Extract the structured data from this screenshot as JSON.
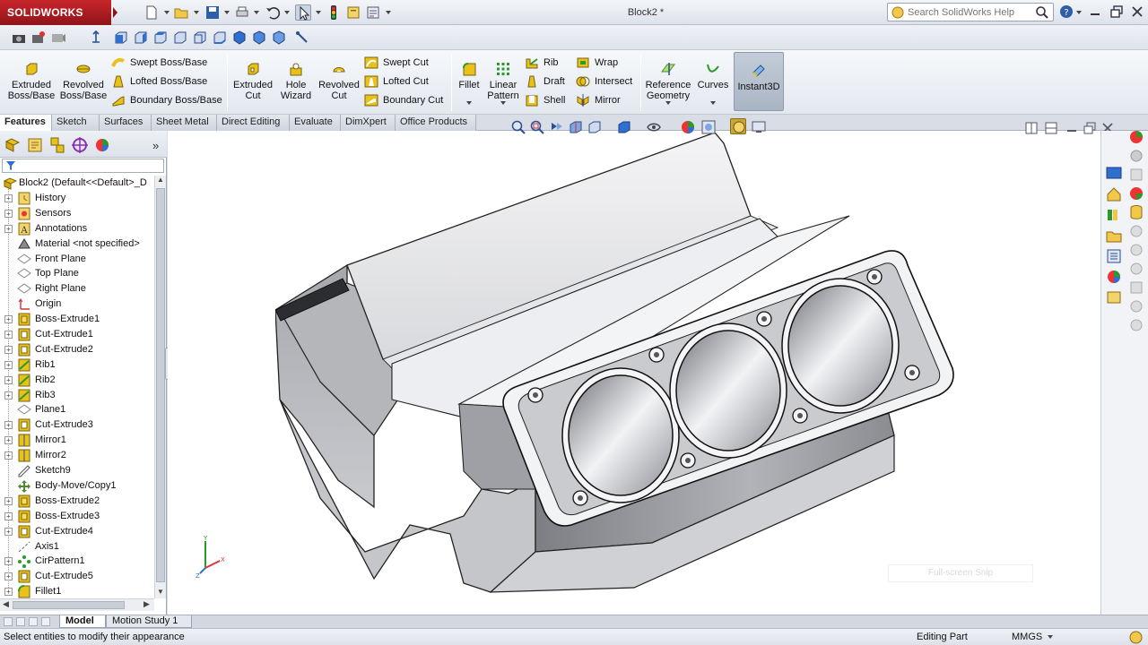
{
  "app": {
    "logo_text": "SOLIDWORKS",
    "document_title": "Block2 *"
  },
  "search": {
    "placeholder": "Search SolidWorks Help"
  },
  "command_manager": {
    "extrude_group": [
      {
        "label": "Extruded\nBoss/Base"
      },
      {
        "label": "Revolved\nBoss/Base"
      }
    ],
    "boss_small": [
      {
        "label": "Swept Boss/Base"
      },
      {
        "label": "Lofted Boss/Base"
      },
      {
        "label": "Boundary Boss/Base"
      }
    ],
    "cut_group": [
      {
        "label": "Extruded\nCut"
      },
      {
        "label": "Hole\nWizard"
      },
      {
        "label": "Revolved\nCut"
      }
    ],
    "cut_small": [
      {
        "label": "Swept Cut"
      },
      {
        "label": "Lofted Cut"
      },
      {
        "label": "Boundary Cut"
      }
    ],
    "fillet": {
      "label": "Fillet"
    },
    "linear_pattern": {
      "label": "Linear\nPattern"
    },
    "feature_small_a": [
      {
        "label": "Rib"
      },
      {
        "label": "Draft"
      },
      {
        "label": "Shell"
      }
    ],
    "feature_small_b": [
      {
        "label": "Wrap"
      },
      {
        "label": "Intersect"
      },
      {
        "label": "Mirror"
      }
    ],
    "reference_geometry": {
      "label": "Reference\nGeometry"
    },
    "curves": {
      "label": "Curves"
    },
    "instant3d": {
      "label": "Instant3D"
    }
  },
  "tabs": [
    {
      "label": "Features"
    },
    {
      "label": "Sketch"
    },
    {
      "label": "Surfaces"
    },
    {
      "label": "Sheet Metal"
    },
    {
      "label": "Direct Editing"
    },
    {
      "label": "Evaluate"
    },
    {
      "label": "DimXpert"
    },
    {
      "label": "Office Products"
    }
  ],
  "feature_tree": {
    "root": "Block2  (Default<<Default>_D",
    "items": [
      {
        "label": "History",
        "icon": "history-icon"
      },
      {
        "label": "Sensors",
        "icon": "sensor-icon"
      },
      {
        "label": "Annotations",
        "icon": "annotation-icon"
      },
      {
        "label": "Material <not specified>",
        "icon": "material-icon"
      },
      {
        "label": "Front Plane",
        "icon": "plane-icon"
      },
      {
        "label": "Top Plane",
        "icon": "plane-icon"
      },
      {
        "label": "Right Plane",
        "icon": "plane-icon"
      },
      {
        "label": "Origin",
        "icon": "origin-icon"
      },
      {
        "label": "Boss-Extrude1",
        "icon": "extrude-icon"
      },
      {
        "label": "Cut-Extrude1",
        "icon": "cut-icon"
      },
      {
        "label": "Cut-Extrude2",
        "icon": "cut-icon"
      },
      {
        "label": "Rib1",
        "icon": "rib-icon"
      },
      {
        "label": "Rib2",
        "icon": "rib-icon"
      },
      {
        "label": "Rib3",
        "icon": "rib-icon"
      },
      {
        "label": "Plane1",
        "icon": "plane-icon"
      },
      {
        "label": "Cut-Extrude3",
        "icon": "cut-icon"
      },
      {
        "label": "Mirror1",
        "icon": "mirror-icon"
      },
      {
        "label": "Mirror2",
        "icon": "mirror-icon"
      },
      {
        "label": "Sketch9",
        "icon": "sketch-icon"
      },
      {
        "label": "Body-Move/Copy1",
        "icon": "move-icon"
      },
      {
        "label": "Boss-Extrude2",
        "icon": "extrude-icon"
      },
      {
        "label": "Boss-Extrude3",
        "icon": "extrude-icon"
      },
      {
        "label": "Cut-Extrude4",
        "icon": "cut-icon"
      },
      {
        "label": "Axis1",
        "icon": "axis-icon"
      },
      {
        "label": "CirPattern1",
        "icon": "pattern-icon"
      },
      {
        "label": "Cut-Extrude5",
        "icon": "cut-icon"
      },
      {
        "label": "Fillet1",
        "icon": "fillet-icon"
      }
    ]
  },
  "viewport": {
    "snip_hint": "Full-screen Snip"
  },
  "bottom_tabs": [
    {
      "label": "Model"
    },
    {
      "label": "Motion Study 1"
    }
  ],
  "status": {
    "message": "Select entities to modify their appearance",
    "mode": "Editing Part",
    "units": "MMGS"
  },
  "colors": {
    "brand_red": "#c8262c",
    "feature_yellow": "#e8c21a",
    "tree_green": "#4d8a2c"
  }
}
